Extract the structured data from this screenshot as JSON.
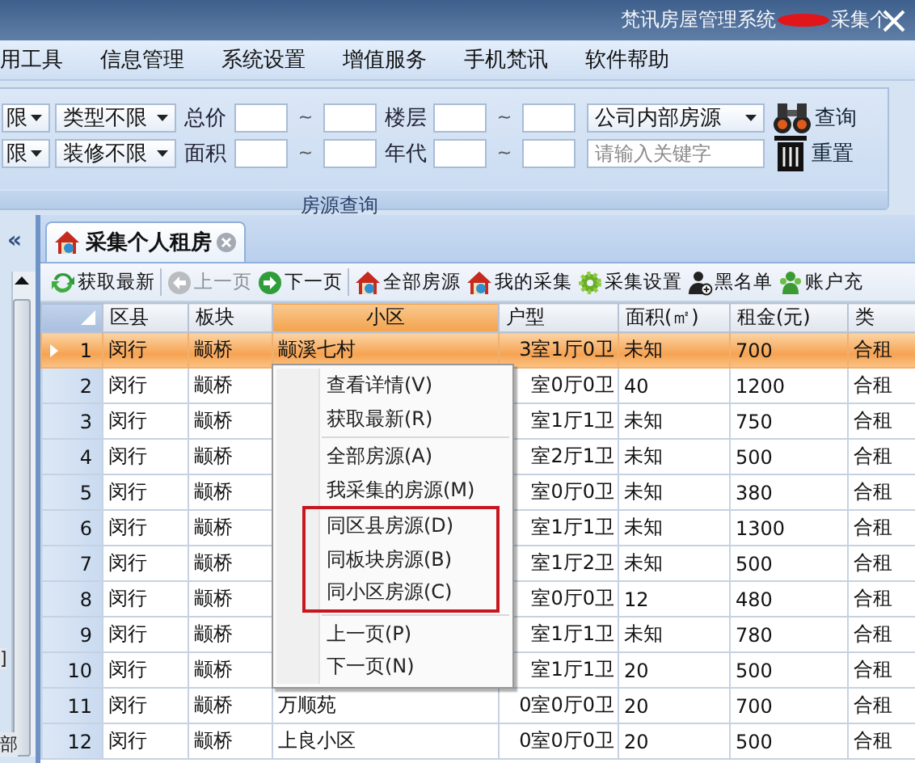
{
  "window": {
    "title": "梵讯房屋管理系统",
    "title_tail": "采集个"
  },
  "menu": [
    "用工具",
    "信息管理",
    "系统设置",
    "增值服务",
    "手机梵讯",
    "软件帮助"
  ],
  "search": {
    "caption": "房源查询",
    "rows": [
      {
        "select_a": "限",
        "select_b": "类型不限",
        "range_1": {
          "label": "总价",
          "tilde": "~"
        },
        "range_2": {
          "label": "楼层",
          "tilde": "~"
        },
        "field": {
          "kind": "select",
          "value": "公司内部房源"
        },
        "button": {
          "kind": "query",
          "label": "查询"
        }
      },
      {
        "select_a": "限",
        "select_b": "装修不限",
        "range_1": {
          "label": "面积",
          "tilde": "~"
        },
        "range_2": {
          "label": "年代",
          "tilde": "~"
        },
        "field": {
          "kind": "input",
          "placeholder": "请输入关键字"
        },
        "button": {
          "kind": "reset",
          "label": "重置"
        }
      }
    ]
  },
  "side_panel": {
    "collapse": "«",
    "fragments": [
      "]",
      "部"
    ]
  },
  "tabs": [
    {
      "label": "采集个人租房",
      "selected": true
    }
  ],
  "toolbar": [
    [
      {
        "label": "获取最新",
        "disabled": false
      }
    ],
    [
      {
        "label": "上一页",
        "disabled": true
      },
      {
        "label": "下一页",
        "disabled": false
      }
    ],
    [
      {
        "label": "全部房源",
        "disabled": false
      },
      {
        "label": "我的采集",
        "disabled": false
      },
      {
        "label": "采集设置",
        "disabled": false
      },
      {
        "label": "黑名单",
        "disabled": false
      },
      {
        "label": "账户充",
        "disabled": false
      }
    ]
  ],
  "grid": {
    "columns": [
      {
        "label": "区县",
        "highlighted": false
      },
      {
        "label": "板块",
        "highlighted": false
      },
      {
        "label": "小区",
        "highlighted": true
      },
      {
        "label": "户型",
        "highlighted": false
      },
      {
        "label": "面积(㎡)",
        "highlighted": false
      },
      {
        "label": "租金(元)",
        "highlighted": false
      },
      {
        "label": "类",
        "highlighted": false
      }
    ],
    "rows": [
      {
        "number": "1",
        "selected": true,
        "district": "闵行",
        "block": "颛桥",
        "community": "颛溪七村",
        "layout": "3室1厅0卫",
        "area": "未知",
        "rent": "700",
        "type": "合租"
      },
      {
        "number": "2",
        "selected": false,
        "district": "闵行",
        "block": "颛桥",
        "layout": "室0厅0卫",
        "area": "40",
        "rent": "1200",
        "type": "合租"
      },
      {
        "number": "3",
        "selected": false,
        "district": "闵行",
        "block": "颛桥",
        "layout": "室1厅1卫",
        "area": "未知",
        "rent": "750",
        "type": "合租"
      },
      {
        "number": "4",
        "selected": false,
        "district": "闵行",
        "block": "颛桥",
        "layout": "室2厅1卫",
        "area": "未知",
        "rent": "500",
        "type": "合租"
      },
      {
        "number": "5",
        "selected": false,
        "district": "闵行",
        "block": "颛桥",
        "layout": "室0厅0卫",
        "area": "未知",
        "rent": "380",
        "type": "合租"
      },
      {
        "number": "6",
        "selected": false,
        "district": "闵行",
        "block": "颛桥",
        "layout": "室1厅1卫",
        "area": "未知",
        "rent": "1300",
        "type": "合租"
      },
      {
        "number": "7",
        "selected": false,
        "district": "闵行",
        "block": "颛桥",
        "layout": "室1厅2卫",
        "area": "未知",
        "rent": "500",
        "type": "合租"
      },
      {
        "number": "8",
        "selected": false,
        "district": "闵行",
        "block": "颛桥",
        "layout": "室0厅0卫",
        "area": "12",
        "rent": "480",
        "type": "合租"
      },
      {
        "number": "9",
        "selected": false,
        "district": "闵行",
        "block": "颛桥",
        "layout": "室1厅1卫",
        "area": "未知",
        "rent": "780",
        "type": "合租"
      },
      {
        "number": "10",
        "selected": false,
        "district": "闵行",
        "block": "颛桥",
        "layout": "室1厅1卫",
        "area": "20",
        "rent": "500",
        "type": "合租"
      },
      {
        "number": "11",
        "selected": false,
        "district": "闵行",
        "block": "颛桥",
        "community": "万顺苑",
        "layout": "0室0厅0卫",
        "area": "20",
        "rent": "700",
        "type": "合租"
      },
      {
        "number": "12",
        "selected": false,
        "district": "闵行",
        "block": "颛桥",
        "community": "上良小区",
        "layout": "0室0厅0卫",
        "area": "20",
        "rent": "500",
        "type": "合租"
      }
    ]
  },
  "context_menu": {
    "groups": [
      {
        "separator_before": false,
        "framed": false,
        "items": [
          "查看详情(V)",
          "获取最新(R)"
        ]
      },
      {
        "separator_before": true,
        "framed": false,
        "items": [
          "全部房源(A)",
          "我采集的房源(M)"
        ]
      },
      {
        "separator_before": false,
        "framed": true,
        "items": [
          "同区县房源(D)",
          "同板块房源(B)",
          "同小区房源(C)"
        ]
      },
      {
        "separator_before": true,
        "framed": false,
        "items": [
          "上一页(P)",
          "下一页(N)"
        ]
      }
    ]
  }
}
